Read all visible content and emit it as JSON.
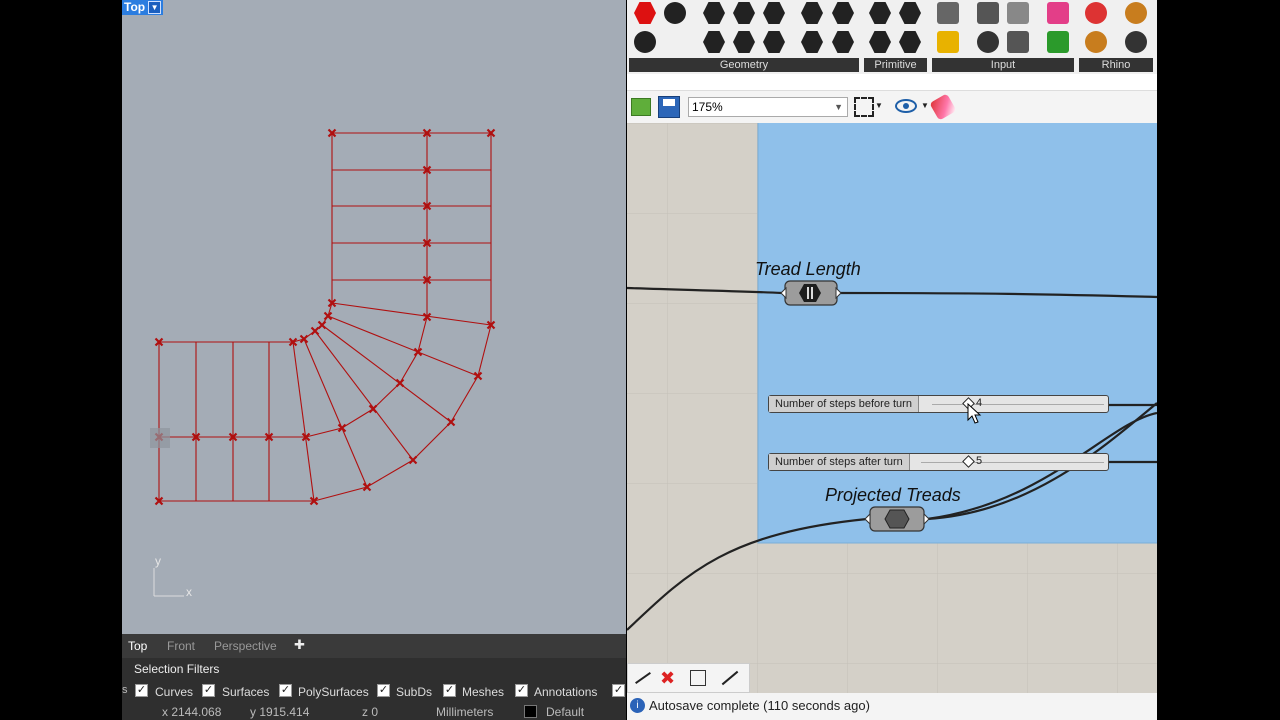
{
  "rhino": {
    "viewport_label": "Top",
    "tabs": [
      "Top",
      "Front",
      "Perspective"
    ],
    "add_tab_glyph": "✚",
    "axis_y": "y",
    "axis_x": "x",
    "selection_filters_title": "Selection Filters",
    "filters": [
      "Curves",
      "Surfaces",
      "PolySurfaces",
      "SubDs",
      "Meshes",
      "Annotations"
    ],
    "status": {
      "x": "x 2144.068",
      "y": "y 1915.414",
      "z": "z 0",
      "units": "Millimeters",
      "layer": "Default"
    }
  },
  "grasshopper": {
    "panels": [
      "Geometry",
      "Primitive",
      "Input",
      "Rhino"
    ],
    "zoom": "175%",
    "group_components": {
      "tread_length": "Tread Length",
      "projected_treads": "Projected Treads"
    },
    "sliders": [
      {
        "label": "Number of steps before turn",
        "value": "4"
      },
      {
        "label": "Number of steps after turn",
        "value": "5"
      }
    ],
    "status_message": "Autosave complete (110 seconds ago)"
  },
  "colors": {
    "accent": "#2b7de0",
    "curve": "#b01010",
    "group": "#8fc0ea"
  }
}
